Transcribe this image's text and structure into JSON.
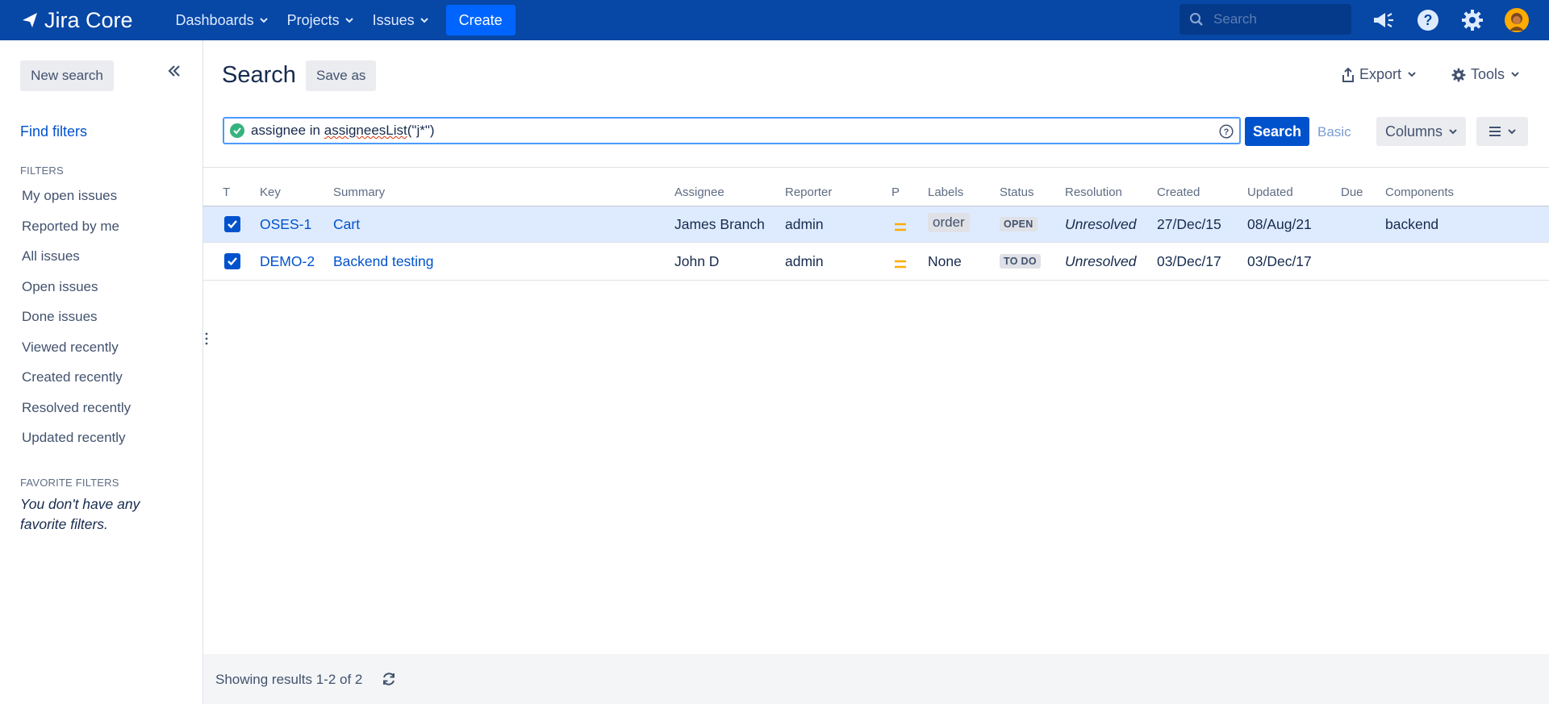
{
  "header": {
    "logo_text": "Jira Core",
    "nav": [
      {
        "label": "Dashboards"
      },
      {
        "label": "Projects"
      },
      {
        "label": "Issues"
      }
    ],
    "create_label": "Create",
    "search_placeholder": "Search"
  },
  "sidebar": {
    "new_search_label": "New search",
    "find_filters_label": "Find filters",
    "filters_heading": "FILTERS",
    "filters": [
      {
        "label": "My open issues"
      },
      {
        "label": "Reported by me"
      },
      {
        "label": "All issues"
      },
      {
        "label": "Open issues"
      },
      {
        "label": "Done issues"
      },
      {
        "label": "Viewed recently"
      },
      {
        "label": "Created recently"
      },
      {
        "label": "Resolved recently"
      },
      {
        "label": "Updated recently"
      }
    ],
    "favorites_heading": "FAVORITE FILTERS",
    "favorites_empty": "You don't have any favorite filters."
  },
  "main": {
    "title": "Search",
    "save_as_label": "Save as",
    "export_label": "Export",
    "tools_label": "Tools",
    "jql_prefix": "assignee in ",
    "jql_func": "assigneesList",
    "jql_suffix": "(\"j*\")",
    "search_button_label": "Search",
    "basic_label": "Basic",
    "columns_label": "Columns"
  },
  "table": {
    "headers": {
      "t": "T",
      "key": "Key",
      "summary": "Summary",
      "assignee": "Assignee",
      "reporter": "Reporter",
      "p": "P",
      "labels": "Labels",
      "status": "Status",
      "resolution": "Resolution",
      "created": "Created",
      "updated": "Updated",
      "due": "Due",
      "components": "Components"
    },
    "rows": [
      {
        "key": "OSES-1",
        "summary": "Cart",
        "assignee": "James Branch",
        "reporter": "admin",
        "priority": "Medium",
        "label": "order",
        "status": "OPEN",
        "resolution": "Unresolved",
        "created": "27/Dec/15",
        "updated": "08/Aug/21",
        "due": "",
        "components": "backend",
        "selected": true
      },
      {
        "key": "DEMO-2",
        "summary": "Backend testing",
        "assignee": "John D",
        "reporter": "admin",
        "priority": "Medium",
        "label": "None",
        "status": "TO DO",
        "resolution": "Unresolved",
        "created": "03/Dec/17",
        "updated": "03/Dec/17",
        "due": "",
        "components": "",
        "selected": false
      }
    ]
  },
  "footer": {
    "results_text": "Showing results 1-2 of 2"
  },
  "colors": {
    "header_bg": "#0747a6",
    "primary": "#0052cc",
    "create_btn": "#0065ff",
    "priority_medium": "#ffab00",
    "selected_row": "#deebff"
  }
}
